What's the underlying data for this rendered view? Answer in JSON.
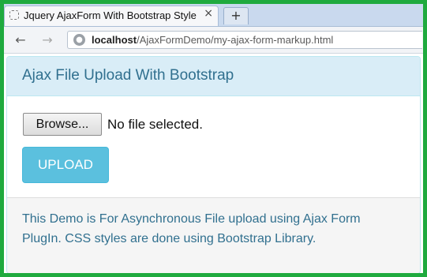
{
  "browser": {
    "tab_title": "Jquery AjaxForm With Bootstrap Style",
    "tab_close_glyph": "×",
    "new_tab_glyph": "+",
    "back_glyph": "←",
    "forward_glyph": "→",
    "url_host": "localhost",
    "url_path": "/AjaxFormDemo/my-ajax-form-markup.html",
    "icons": {
      "tab": "page-icon",
      "back": "back-arrow-icon",
      "forward": "forward-arrow-icon",
      "site": "globe-icon"
    }
  },
  "panel": {
    "title": "Ajax File Upload With Bootstrap",
    "browse_label": "Browse...",
    "file_status": "No file selected.",
    "upload_label": "UPLOAD",
    "footer_text": "This Demo is For Asynchronous File upload using Ajax Form PlugIn. CSS styles are done using Bootstrap Library."
  },
  "colors": {
    "frame_border": "#1faa3e",
    "panel_heading_bg": "#d9edf7",
    "panel_text": "#31708f",
    "upload_button_bg": "#5bc0de"
  }
}
